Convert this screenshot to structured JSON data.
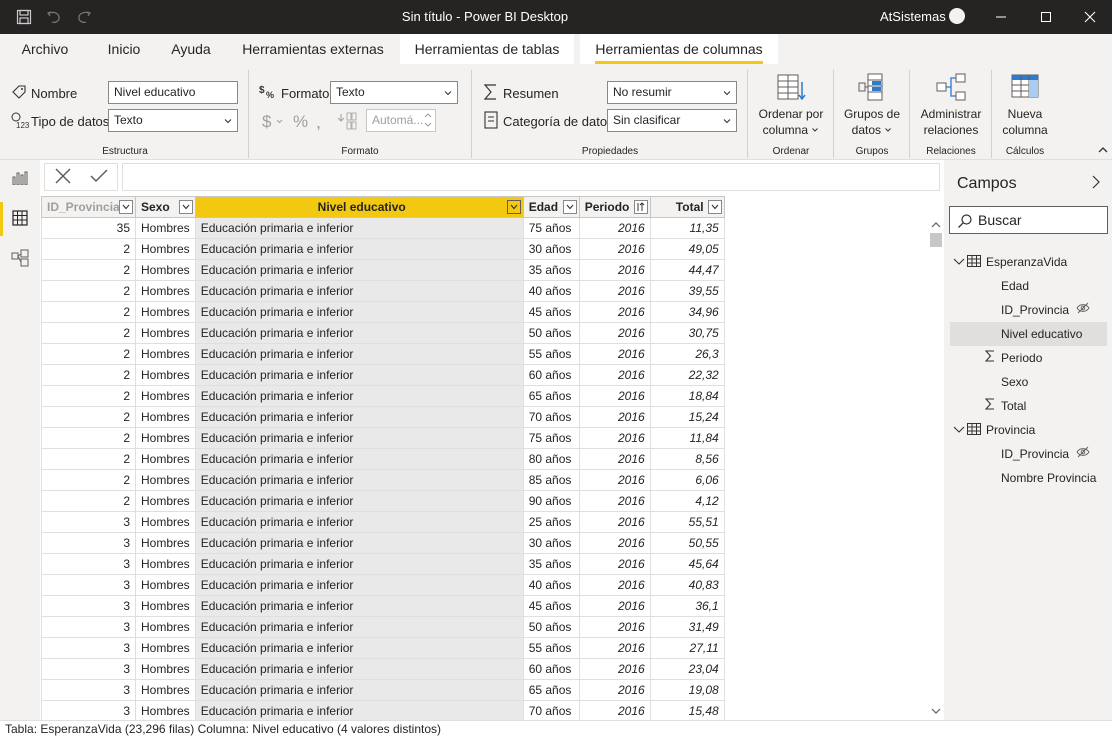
{
  "window": {
    "title": "Sin título - Power BI Desktop",
    "user": "AtSistemas"
  },
  "tabs": [
    {
      "label": "Archivo"
    },
    {
      "label": "Inicio"
    },
    {
      "label": "Ayuda"
    },
    {
      "label": "Herramientas externas"
    },
    {
      "label": "Herramientas de tablas"
    },
    {
      "label": "Herramientas de columnas"
    }
  ],
  "ribbon": {
    "estructura": {
      "nombre_label": "Nombre",
      "nombre_value": "Nivel educativo",
      "tipo_label": "Tipo de datos",
      "tipo_value": "Texto",
      "group": "Estructura"
    },
    "formato": {
      "formato_label": "Formato",
      "formato_value": "Texto",
      "auto_value": "Automá...",
      "group": "Formato"
    },
    "propiedades": {
      "resumen_label": "Resumen",
      "resumen_value": "No resumir",
      "categoria_label": "Categoría de datos",
      "categoria_value": "Sin clasificar",
      "group": "Propiedades"
    },
    "ordenar": {
      "line1": "Ordenar por",
      "line2": "columna",
      "group": "Ordenar"
    },
    "grupos": {
      "line1": "Grupos de",
      "line2": "datos",
      "group": "Grupos"
    },
    "relaciones": {
      "line1": "Administrar",
      "line2": "relaciones",
      "group": "Relaciones"
    },
    "calculos": {
      "line1": "Nueva",
      "line2": "columna",
      "group": "Cálculos"
    }
  },
  "table": {
    "columns": [
      "ID_Provincia",
      "Sexo",
      "Nivel educativo",
      "Edad",
      "Periodo",
      "Total"
    ],
    "rows": [
      [
        "35",
        "Hombres",
        "Educación primaria e inferior",
        "75 años",
        "2016",
        "11,35"
      ],
      [
        "2",
        "Hombres",
        "Educación primaria e inferior",
        "30 años",
        "2016",
        "49,05"
      ],
      [
        "2",
        "Hombres",
        "Educación primaria e inferior",
        "35 años",
        "2016",
        "44,47"
      ],
      [
        "2",
        "Hombres",
        "Educación primaria e inferior",
        "40 años",
        "2016",
        "39,55"
      ],
      [
        "2",
        "Hombres",
        "Educación primaria e inferior",
        "45 años",
        "2016",
        "34,96"
      ],
      [
        "2",
        "Hombres",
        "Educación primaria e inferior",
        "50 años",
        "2016",
        "30,75"
      ],
      [
        "2",
        "Hombres",
        "Educación primaria e inferior",
        "55 años",
        "2016",
        "26,3"
      ],
      [
        "2",
        "Hombres",
        "Educación primaria e inferior",
        "60 años",
        "2016",
        "22,32"
      ],
      [
        "2",
        "Hombres",
        "Educación primaria e inferior",
        "65 años",
        "2016",
        "18,84"
      ],
      [
        "2",
        "Hombres",
        "Educación primaria e inferior",
        "70 años",
        "2016",
        "15,24"
      ],
      [
        "2",
        "Hombres",
        "Educación primaria e inferior",
        "75 años",
        "2016",
        "11,84"
      ],
      [
        "2",
        "Hombres",
        "Educación primaria e inferior",
        "80 años",
        "2016",
        "8,56"
      ],
      [
        "2",
        "Hombres",
        "Educación primaria e inferior",
        "85 años",
        "2016",
        "6,06"
      ],
      [
        "2",
        "Hombres",
        "Educación primaria e inferior",
        "90 años",
        "2016",
        "4,12"
      ],
      [
        "3",
        "Hombres",
        "Educación primaria e inferior",
        "25 años",
        "2016",
        "55,51"
      ],
      [
        "3",
        "Hombres",
        "Educación primaria e inferior",
        "30 años",
        "2016",
        "50,55"
      ],
      [
        "3",
        "Hombres",
        "Educación primaria e inferior",
        "35 años",
        "2016",
        "45,64"
      ],
      [
        "3",
        "Hombres",
        "Educación primaria e inferior",
        "40 años",
        "2016",
        "40,83"
      ],
      [
        "3",
        "Hombres",
        "Educación primaria e inferior",
        "45 años",
        "2016",
        "36,1"
      ],
      [
        "3",
        "Hombres",
        "Educación primaria e inferior",
        "50 años",
        "2016",
        "31,49"
      ],
      [
        "3",
        "Hombres",
        "Educación primaria e inferior",
        "55 años",
        "2016",
        "27,11"
      ],
      [
        "3",
        "Hombres",
        "Educación primaria e inferior",
        "60 años",
        "2016",
        "23,04"
      ],
      [
        "3",
        "Hombres",
        "Educación primaria e inferior",
        "65 años",
        "2016",
        "19,08"
      ],
      [
        "3",
        "Hombres",
        "Educación primaria e inferior",
        "70 años",
        "2016",
        "15,48"
      ]
    ]
  },
  "fields": {
    "title": "Campos",
    "search_placeholder": "Buscar",
    "tables": [
      {
        "name": "EsperanzaVida",
        "fields": [
          {
            "name": "Edad",
            "sigma": false,
            "hidden": false
          },
          {
            "name": "ID_Provincia",
            "sigma": false,
            "hidden": true
          },
          {
            "name": "Nivel educativo",
            "sigma": false,
            "hidden": false,
            "selected": true
          },
          {
            "name": "Periodo",
            "sigma": true,
            "hidden": false
          },
          {
            "name": "Sexo",
            "sigma": false,
            "hidden": false
          },
          {
            "name": "Total",
            "sigma": true,
            "hidden": false
          }
        ]
      },
      {
        "name": "Provincia",
        "fields": [
          {
            "name": "ID_Provincia",
            "sigma": false,
            "hidden": true
          },
          {
            "name": "Nombre Provincia",
            "sigma": false,
            "hidden": false
          }
        ]
      }
    ]
  },
  "status": "Tabla: EsperanzaVida (23,296 filas) Columna: Nivel educativo (4 valores distintos)",
  "colors": {
    "accent": "#f2c811",
    "titlebar": "#252423",
    "chrome": "#f3f2f1",
    "icon_blue": "#2b7bcf"
  }
}
